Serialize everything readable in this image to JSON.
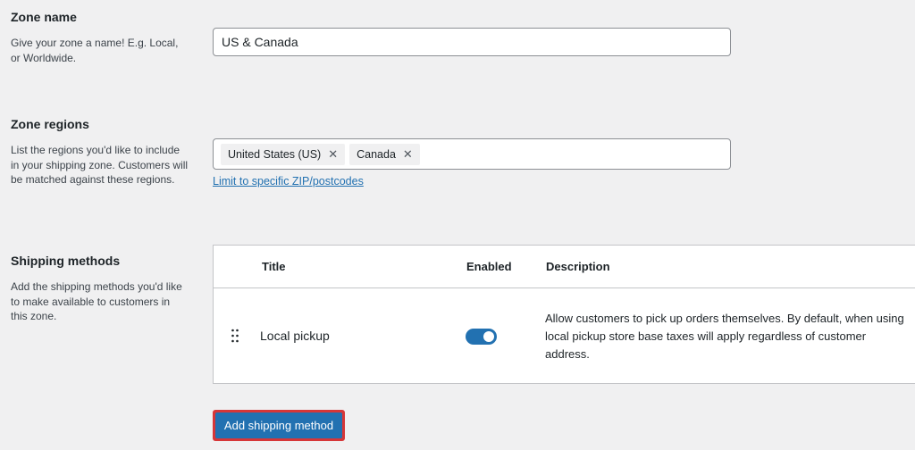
{
  "zone_name": {
    "title": "Zone name",
    "description": "Give your zone a name! E.g. Local, or Worldwide.",
    "value": "US & Canada"
  },
  "zone_regions": {
    "title": "Zone regions",
    "description": "List the regions you'd like to include in your shipping zone. Customers will be matched against these regions.",
    "tags": [
      {
        "label": "United States (US)",
        "remove_glyph": "✕"
      },
      {
        "label": "Canada",
        "remove_glyph": "✕"
      }
    ],
    "postcode_link": "Limit to specific ZIP/postcodes"
  },
  "shipping_methods": {
    "title": "Shipping methods",
    "description": "Add the shipping methods you'd like to make available to customers in this zone.",
    "columns": {
      "title": "Title",
      "enabled": "Enabled",
      "description": "Description"
    },
    "rows": [
      {
        "title": "Local pickup",
        "enabled": true,
        "description": "Allow customers to pick up orders themselves. By default, when using local pickup store base taxes will apply regardless of customer address."
      }
    ],
    "add_button": "Add shipping method"
  },
  "colors": {
    "accent": "#2271b1",
    "highlight_border": "#d63638",
    "background": "#f0f0f1"
  }
}
